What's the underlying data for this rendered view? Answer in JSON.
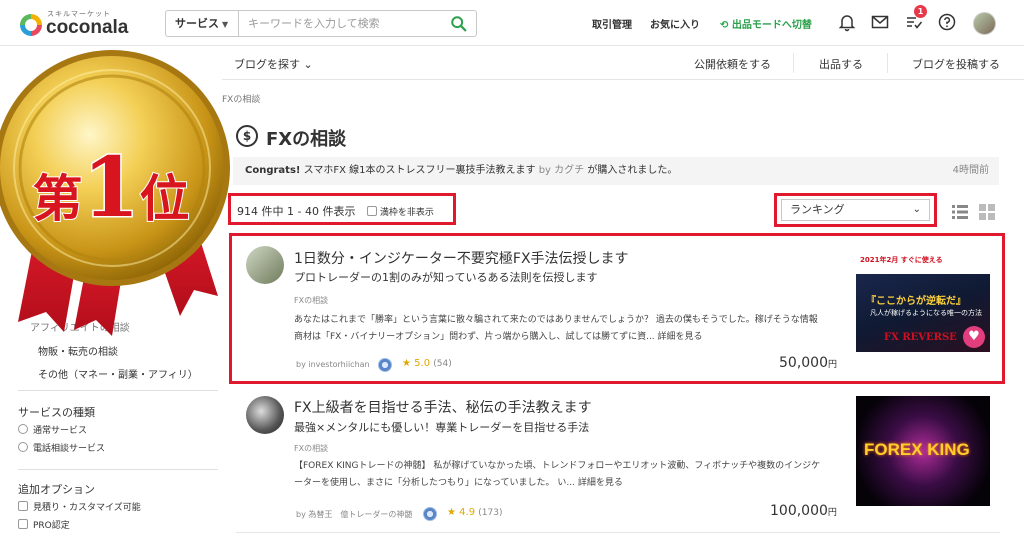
{
  "header": {
    "logo_kana": "スキルマーケット",
    "logo_word": "coconala",
    "search_category": "サービス",
    "search_placeholder": "キーワードを入力して検索",
    "links": {
      "transactions": "取引管理",
      "favorites": "お気に入り",
      "seller_mode": "出品モードへ切替"
    },
    "notification_count": "1"
  },
  "subnav": {
    "blog_search": "ブログを探す",
    "request": "公開依頼をする",
    "sell": "出品する",
    "post_blog": "ブログを投稿する"
  },
  "breadcrumb": "FXの相談",
  "page": {
    "title_icon": "$",
    "title": "FXの相談"
  },
  "congrats": {
    "label": "Congrats!",
    "service": "スマホFX 線1本のストレスフリー裏技手法教えます",
    "by": "by",
    "buyer": "カグチ",
    "message": "が購入されました。",
    "time": "4時間前"
  },
  "results": {
    "count": "914 件中 1 - 40 件表示",
    "hide_full": "満枠を非表示",
    "sort": "ランキング"
  },
  "services": [
    {
      "title": "1日数分・インジケーター不要究極FX手法伝授します",
      "subtitle": "プロトレーダーの1割のみが知っているある法則を伝授します",
      "category": "FXの相談",
      "description": "あなたはこれまで「勝率」という言葉に散々騙されて来たのではありませんでしょうか？ 過去の僕もそうでした。稼げそうな情報商材は「FX・バイナリーオプション」問わず、片っ端から購入し、試しては勝てずに資... 詳細を見る",
      "seller": "by investorhiichan",
      "rating": "5.0",
      "reviews": "(54)",
      "price": "50,000",
      "currency": "円",
      "thumb_text": {
        "line1": "2021年2月 すぐに使える",
        "line2": "『ここからが逆転だ』",
        "line3": "凡人が稼げるようになる唯一の方法",
        "line4": "FX REVERSE"
      }
    },
    {
      "title": "FX上級者を目指せる手法、秘伝の手法教えます",
      "subtitle": "最強×メンタルにも優しい！専業トレーダーを目指せる手法",
      "category": "FXの相談",
      "description": "【FOREX KINGトレードの神髄】 私が稼げていなかった頃、トレンドフォローやエリオット波動、フィボナッチや複数のインジケーターを使用し、まさに「分析したつもり」になっていました。 い... 詳細を見る",
      "seller": "by 為替王　億トレーダーの神髄",
      "rating": "4.9",
      "reviews": "(173)",
      "price": "100,000",
      "currency": "円",
      "thumb_text": "FOREX KING"
    }
  ],
  "sidebar": {
    "partial_item": "アフィリエイトの相談",
    "items": [
      "物販・転売の相談",
      "その他（マネー・副業・アフィリ）"
    ],
    "service_type_heading": "サービスの種類",
    "service_types": [
      "通常サービス",
      "電話相談サービス"
    ],
    "options_heading": "追加オプション",
    "options": [
      "見積り・カスタマイズ可能",
      "PRO認定"
    ]
  },
  "medal": {
    "kanji_first": "第",
    "number": "1",
    "kanji_rank": "位"
  },
  "colors": {
    "highlight_red": "#e0192e",
    "accent_green": "#2aa14a",
    "star_gold": "#e0a800",
    "medal_red": "#d8141e"
  }
}
